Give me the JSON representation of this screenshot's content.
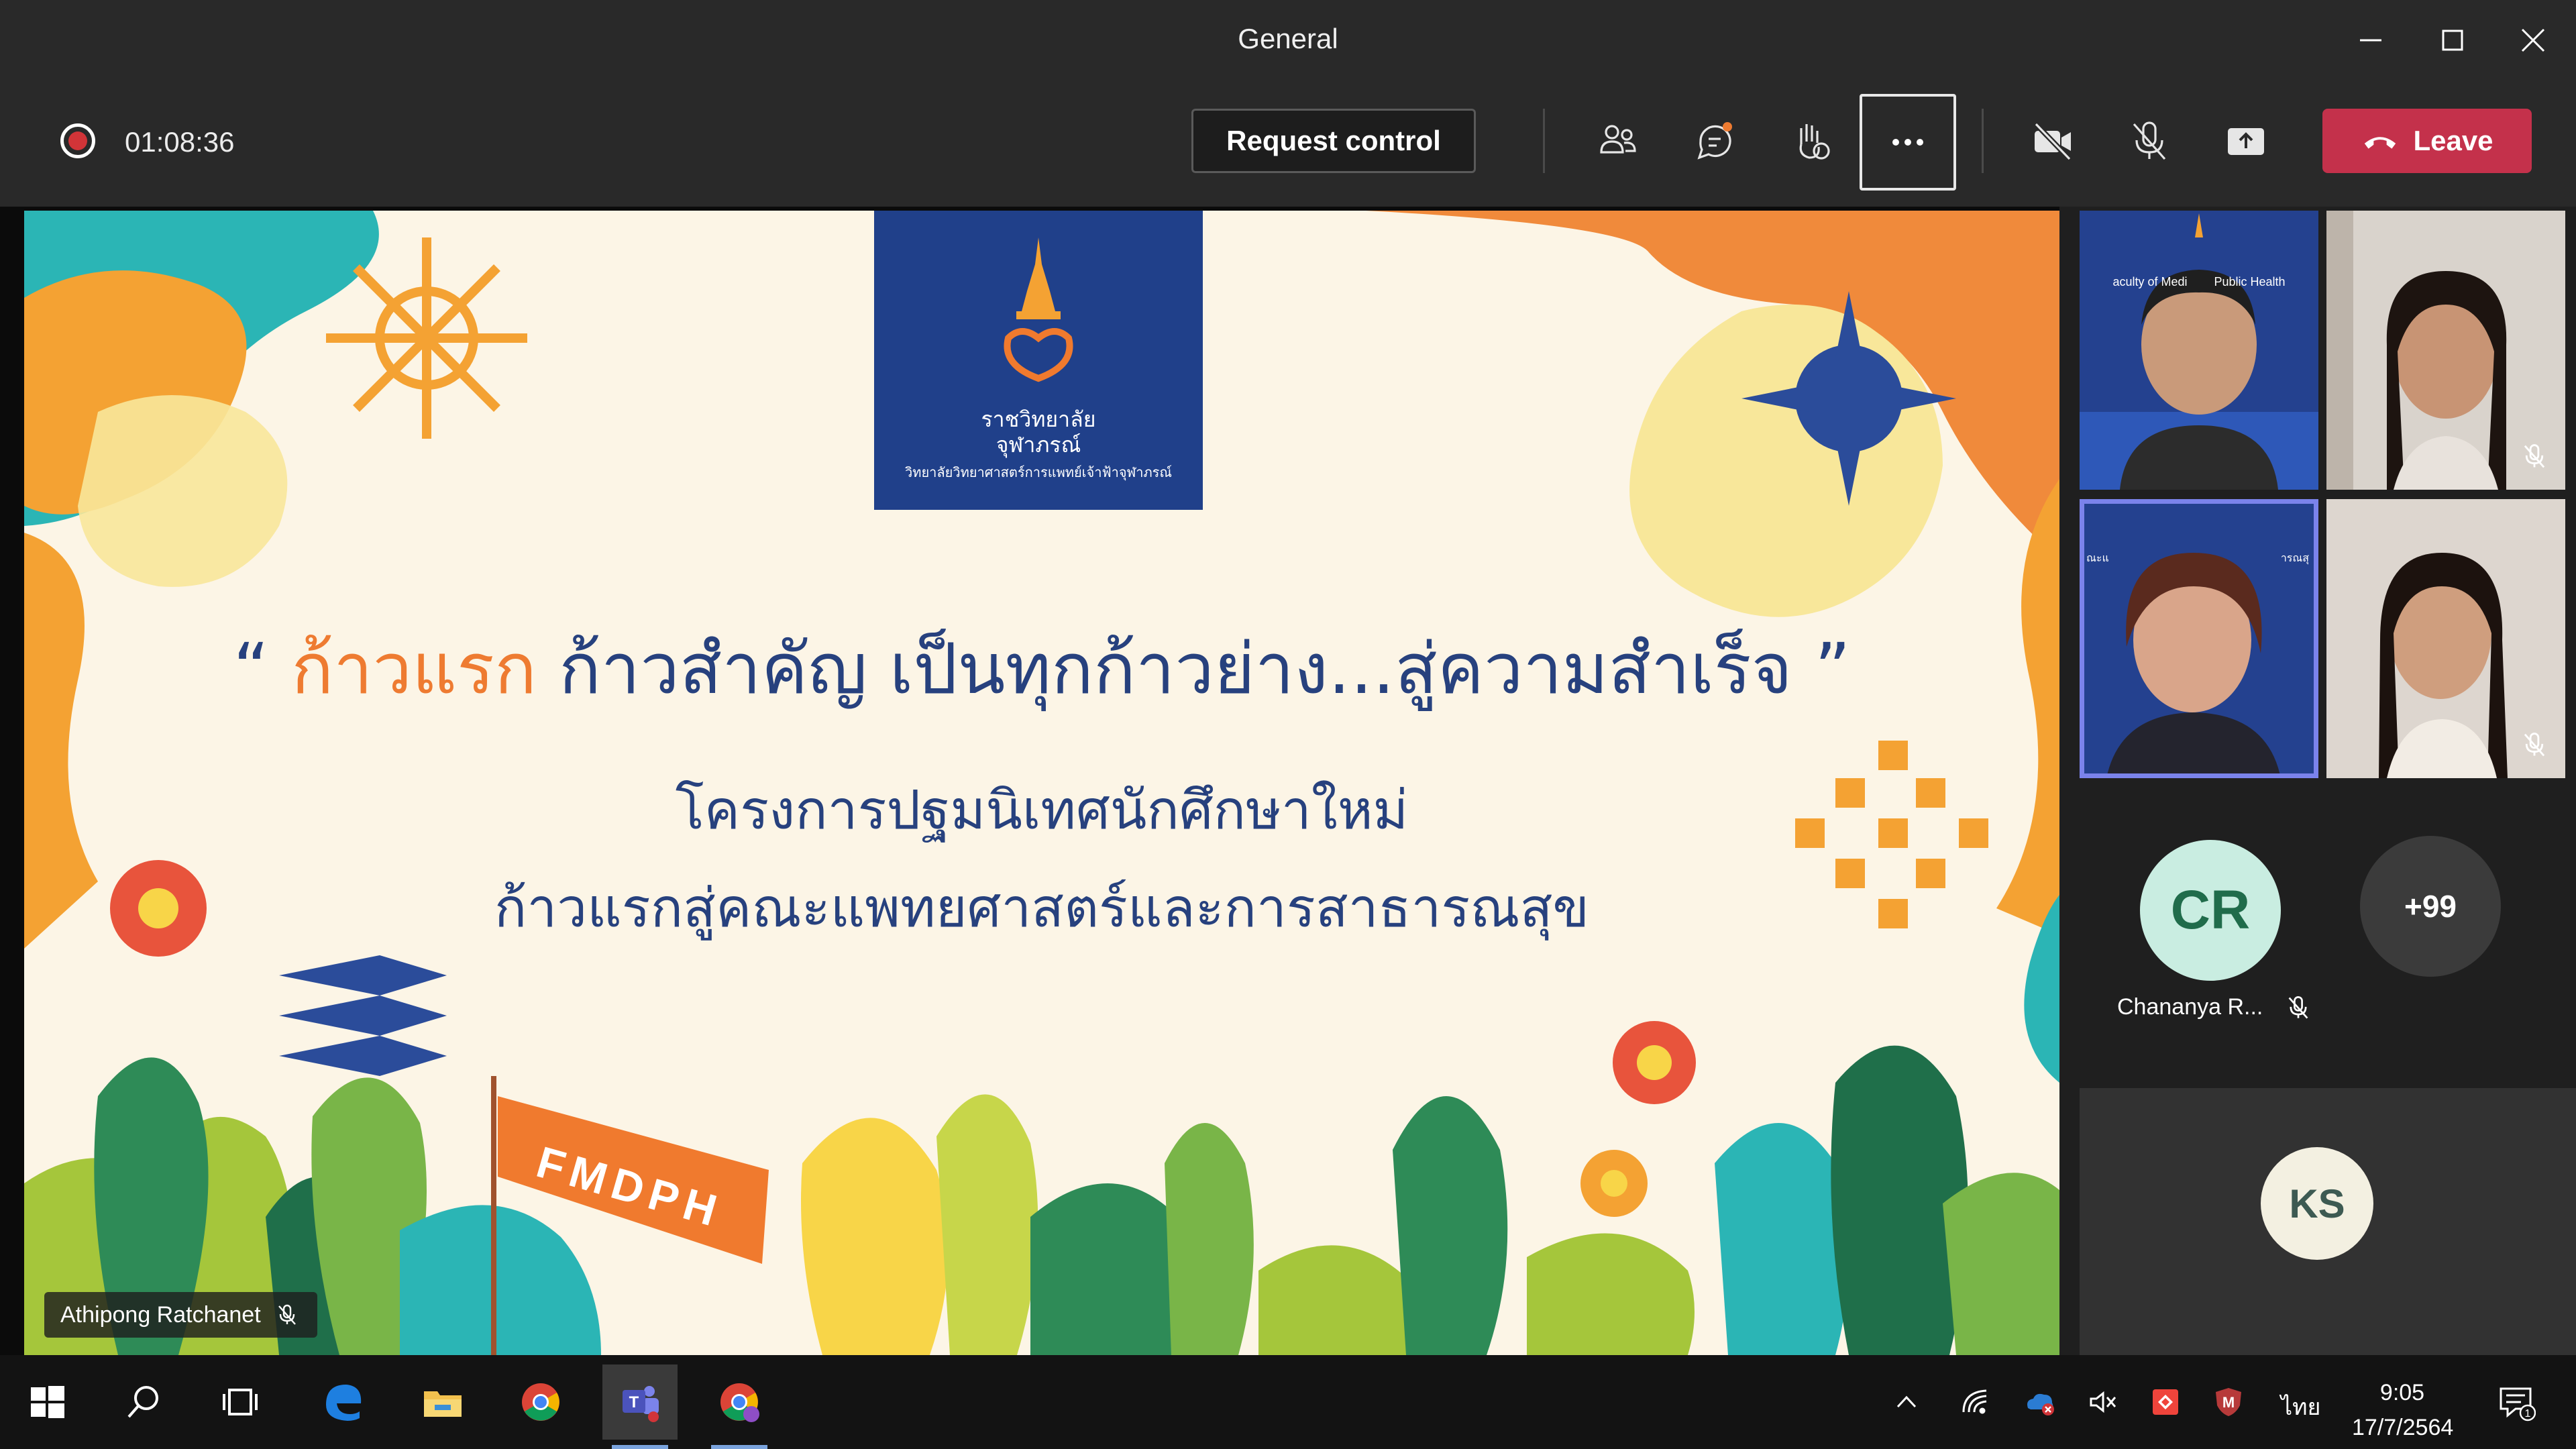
{
  "window": {
    "title": "General"
  },
  "meeting": {
    "recording_icon": "recording-icon",
    "timer": "01:08:36",
    "request_control_label": "Request control",
    "leave_label": "Leave",
    "leave_color": "#c4314b",
    "toolbar_icons": [
      "participants-icon",
      "chat-icon",
      "reactions-icon",
      "more-options-icon",
      "camera-off-icon",
      "mic-off-icon",
      "share-tray-icon"
    ]
  },
  "slide": {
    "logo_line1": "ราชวิทยาลัย",
    "logo_line2": "จุฬาภรณ์",
    "logo_line3": "วิทยาลัยวิทยาศาสตร์การแพทย์เจ้าฟ้าจุฬาภรณ์",
    "headline_open": "“ ",
    "headline_accent": "ก้าวแรก",
    "headline_rest": " ก้าวสำคัญ เป็นทุกก้าวย่าง...สู่ความสำเร็จ ”",
    "subtitle_line1": "โครงการปฐมนิเทศนักศึกษาใหม่",
    "subtitle_line2": "ก้าวแรกสู่คณะแพทยศาสตร์และการสาธารณสุข",
    "flag_text": "FMDPH",
    "accent_color": "#ee7b31",
    "text_color": "#27417e"
  },
  "presenter": {
    "name": "Athipong Ratchanet"
  },
  "gallery": {
    "tile1_banner": "aculty of Medi        Public Health",
    "tile3_banner_left": "ณะแ",
    "tile3_banner_right": "ารณสุ",
    "cr_initials": "CR",
    "cr_name": "Chananya R...",
    "more_count": "+99",
    "ks_initials": "KS"
  },
  "taskbar": {
    "apps": [
      "windows-start-icon",
      "search-icon",
      "task-view-icon",
      "edge-icon",
      "file-explorer-icon",
      "chrome-icon",
      "teams-icon",
      "chrome-profile-icon"
    ],
    "language": "ไทย",
    "time": "9:05",
    "date": "17/7/2564",
    "notification_count": "1"
  }
}
